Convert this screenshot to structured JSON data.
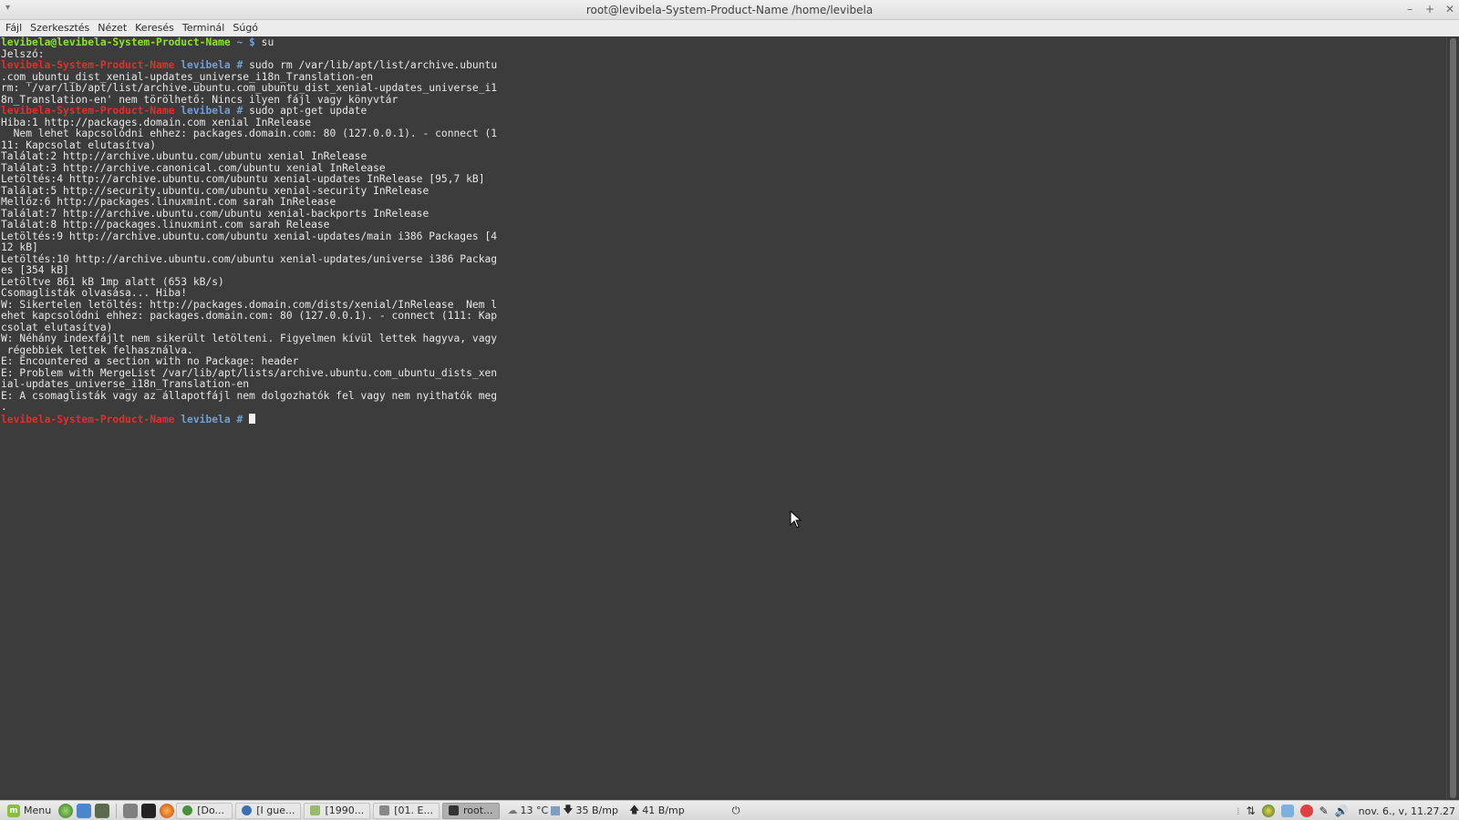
{
  "window": {
    "title": "root@levibela-System-Product-Name /home/levibela",
    "menu_icon": "chevron-down-icon",
    "controls": [
      "–",
      "+",
      "✕"
    ]
  },
  "menubar": {
    "items": [
      "Fájl",
      "Szerkesztés",
      "Nézet",
      "Keresés",
      "Terminál",
      "Súgó"
    ]
  },
  "terminal": {
    "prompt_user": "levibela@levibela-System-Product-Name",
    "prompt_user_tail": " ~ $ ",
    "prompt_host": "levibela-System-Product-Name",
    "prompt_dir": " levibela # ",
    "lines": [
      {
        "kind": "user",
        "cmd": "su"
      },
      {
        "kind": "text",
        "text": "Jelszó:"
      },
      {
        "kind": "root",
        "cmd": "sudo rm /var/lib/apt/list/archive.ubuntu"
      },
      {
        "kind": "text",
        "text": ".com_ubuntu_dist_xenial-updates_universe_i18n_Translation-en"
      },
      {
        "kind": "text",
        "text": "rm: '/var/lib/apt/list/archive.ubuntu.com_ubuntu_dist_xenial-updates_universe_i1"
      },
      {
        "kind": "text",
        "text": "8n_Translation-en' nem törölhető: Nincs ilyen fájl vagy könyvtár"
      },
      {
        "kind": "root",
        "cmd": "sudo apt-get update"
      },
      {
        "kind": "text",
        "text": "Hiba:1 http://packages.domain.com xenial InRelease"
      },
      {
        "kind": "text",
        "text": "  Nem lehet kapcsolódni ehhez: packages.domain.com: 80 (127.0.0.1). - connect (1"
      },
      {
        "kind": "text",
        "text": "11: Kapcsolat elutasítva)"
      },
      {
        "kind": "text",
        "text": "Találat:2 http://archive.ubuntu.com/ubuntu xenial InRelease"
      },
      {
        "kind": "text",
        "text": "Találat:3 http://archive.canonical.com/ubuntu xenial InRelease"
      },
      {
        "kind": "text",
        "text": "Letöltés:4 http://archive.ubuntu.com/ubuntu xenial-updates InRelease [95,7 kB]"
      },
      {
        "kind": "text",
        "text": "Találat:5 http://security.ubuntu.com/ubuntu xenial-security InRelease"
      },
      {
        "kind": "text",
        "text": "Mellőz:6 http://packages.linuxmint.com sarah InRelease"
      },
      {
        "kind": "text",
        "text": "Találat:7 http://archive.ubuntu.com/ubuntu xenial-backports InRelease"
      },
      {
        "kind": "text",
        "text": "Találat:8 http://packages.linuxmint.com sarah Release"
      },
      {
        "kind": "text",
        "text": "Letöltés:9 http://archive.ubuntu.com/ubuntu xenial-updates/main i386 Packages [4"
      },
      {
        "kind": "text",
        "text": "12 kB]"
      },
      {
        "kind": "text",
        "text": "Letöltés:10 http://archive.ubuntu.com/ubuntu xenial-updates/universe i386 Packag"
      },
      {
        "kind": "text",
        "text": "es [354 kB]"
      },
      {
        "kind": "text",
        "text": "Letöltve 861 kB 1mp alatt (653 kB/s)"
      },
      {
        "kind": "text",
        "text": "Csomaglisták olvasása... Hiba!"
      },
      {
        "kind": "text",
        "text": "W: Sikertelen letöltés: http://packages.domain.com/dists/xenial/InRelease  Nem l"
      },
      {
        "kind": "text",
        "text": "ehet kapcsolódni ehhez: packages.domain.com: 80 (127.0.0.1). - connect (111: Kap"
      },
      {
        "kind": "text",
        "text": "csolat elutasítva)"
      },
      {
        "kind": "text",
        "text": "W: Néhány indexfájlt nem sikerült letölteni. Figyelmen kívül lettek hagyva, vagy"
      },
      {
        "kind": "text",
        "text": " régebbiek lettek felhasználva."
      },
      {
        "kind": "text",
        "text": "E: Encountered a section with no Package: header"
      },
      {
        "kind": "text",
        "text": "E: Problem with MergeList /var/lib/apt/lists/archive.ubuntu.com_ubuntu_dists_xen"
      },
      {
        "kind": "text",
        "text": "ial-updates_universe_i18n_Translation-en"
      },
      {
        "kind": "text",
        "text": "E: A csomaglisták vagy az állapotfájl nem dolgozhatók fel vagy nem nyithatók meg"
      },
      {
        "kind": "text",
        "text": "."
      },
      {
        "kind": "root_cursor",
        "cmd": ""
      }
    ]
  },
  "taskbar": {
    "menu_label": "Menu",
    "tasks": [
      {
        "label": "[Do...",
        "icon": "chrome-icon",
        "color": "#4a8f3c"
      },
      {
        "label": "[I gue...",
        "icon": "chrome-icon",
        "color": "#3d6fb4"
      },
      {
        "label": "[1990...",
        "icon": "image-viewer-icon",
        "color": "#9bb870"
      },
      {
        "label": "[01. E...",
        "icon": "document-icon",
        "color": "#888888"
      },
      {
        "label": "root...",
        "icon": "terminal-icon",
        "color": "#333333",
        "active": true
      }
    ],
    "weather": "13 °C",
    "net_down": "35 B/mp",
    "net_up": "41 B/mp",
    "clock": "nov. 6., v, 11.27.27"
  },
  "colors": {
    "terminal_bg": "#3c3c3c",
    "prompt_green": "#8ae234",
    "prompt_red": "#ef2929",
    "prompt_blue": "#729fcf"
  }
}
